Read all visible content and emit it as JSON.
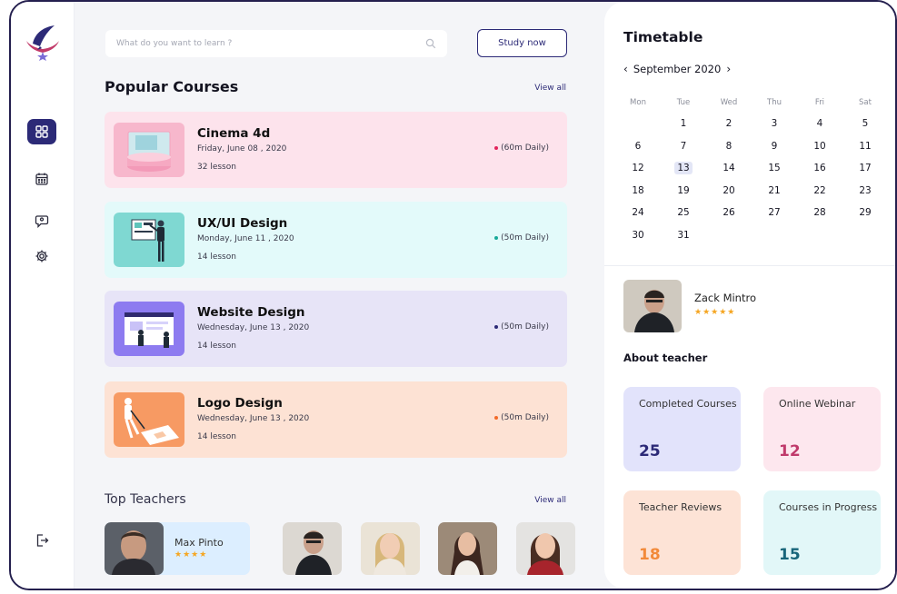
{
  "search": {
    "placeholder": "What do you want to learn ?"
  },
  "header": {
    "study_label": "Study now"
  },
  "popular": {
    "title": "Popular Courses",
    "view_all": "View all",
    "courses": [
      {
        "title": "Cinema 4d",
        "date": "Friday, June 08 , 2020",
        "lessons": "32 lesson",
        "duration": "(60m Daily)",
        "bg": "#fde3ec",
        "dot": "#e2245c"
      },
      {
        "title": "UX/UI Design",
        "date": "Monday, June 11 , 2020",
        "lessons": "14 lesson",
        "duration": "(50m Daily)",
        "bg": "#e3fafa",
        "dot": "#18a999"
      },
      {
        "title": "Website Design",
        "date": "Wednesday, June 13 , 2020",
        "lessons": "14 lesson",
        "duration": "(50m Daily)",
        "bg": "#e7e4f7",
        "dot": "#2c2a77"
      },
      {
        "title": "Logo Design",
        "date": "Wednesday, June 13 , 2020",
        "lessons": "14 lesson",
        "duration": "(50m Daily)",
        "bg": "#fde2d4",
        "dot": "#f26b2a"
      }
    ]
  },
  "teachers": {
    "title": "Top Teachers",
    "view_all": "View all",
    "featured": {
      "name": "Max Pinto",
      "stars": "★★★★"
    }
  },
  "timetable": {
    "title": "Timetable",
    "month": "September 2020",
    "weekdays": [
      "Mon",
      "Tue",
      "Wed",
      "Thu",
      "Fri",
      "Sat"
    ],
    "weeks": [
      [
        "",
        "1",
        "2",
        "3",
        "4",
        "5"
      ],
      [
        "6",
        "7",
        "8",
        "9",
        "10",
        "11"
      ],
      [
        "12",
        "13",
        "14",
        "15",
        "16",
        "17"
      ],
      [
        "18",
        "19",
        "20",
        "21",
        "22",
        "23"
      ],
      [
        "24",
        "25",
        "26",
        "27",
        "28",
        "29"
      ],
      [
        "30",
        "31",
        "",
        "",
        "",
        ""
      ]
    ],
    "today": "13"
  },
  "profile": {
    "name": "Zack Mintro",
    "stars": "★★★★★",
    "about_title": "About teacher"
  },
  "stats": [
    {
      "label": "Completed Courses",
      "value": "25",
      "bg": "#e2e3fb",
      "color": "#2c2a77"
    },
    {
      "label": "Online Webinar",
      "value": "12",
      "bg": "#fde7ee",
      "color": "#c03a6b"
    },
    {
      "label": "Teacher Reviews",
      "value": "18",
      "bg": "#fde3d6",
      "color": "#f28a3a"
    },
    {
      "label": "Courses in Progress",
      "value": "15",
      "bg": "#e2f7f8",
      "color": "#17657a"
    }
  ],
  "icons": [
    "logo-icon",
    "grid-icon",
    "calendar-icon",
    "chat-icon",
    "settings-icon",
    "logout-icon",
    "search-icon",
    "chevron-left-icon",
    "chevron-right-icon"
  ]
}
